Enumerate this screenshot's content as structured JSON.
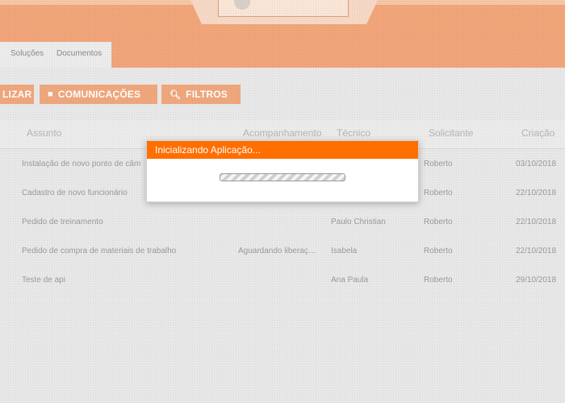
{
  "header": {
    "tabs": [
      "Soluções",
      "Documentos"
    ]
  },
  "toolbar": {
    "atualizar_label": "LIZAR",
    "comunicacoes_label": "COMUNICAÇÕES",
    "filtros_label": "FILTROS"
  },
  "table": {
    "columns": [
      "Assunto",
      "Acompanhamento",
      "Técnico",
      "Solicitante",
      "Criação"
    ],
    "rows": [
      {
        "assunto": "Instalação de novo ponto de câm",
        "acompanhamento": "",
        "tecnico": "",
        "solicitante": "Roberto",
        "criacao": "03/10/2018"
      },
      {
        "assunto": "Cadastro de novo funcionário",
        "acompanhamento": "",
        "tecnico": "",
        "solicitante": "Roberto",
        "criacao": "22/10/2018"
      },
      {
        "assunto": "Pedido de treinamento",
        "acompanhamento": "",
        "tecnico": "Paulo Christian",
        "solicitante": "Roberto",
        "criacao": "22/10/2018"
      },
      {
        "assunto": "Pedido de compra de materiais de trabalho",
        "acompanhamento": "Aguardando liberaç…",
        "tecnico": "Isabela",
        "solicitante": "Roberto",
        "criacao": "22/10/2018"
      },
      {
        "assunto": "Teste de api",
        "acompanhamento": "",
        "tecnico": "Ana Paula",
        "solicitante": "Roberto",
        "criacao": "29/10/2018"
      }
    ]
  },
  "modal": {
    "title": "Inicializando Aplicação..."
  },
  "colors": {
    "accent": "#ff6e00",
    "header": "#f2a67a",
    "button": "#f0a77d"
  }
}
